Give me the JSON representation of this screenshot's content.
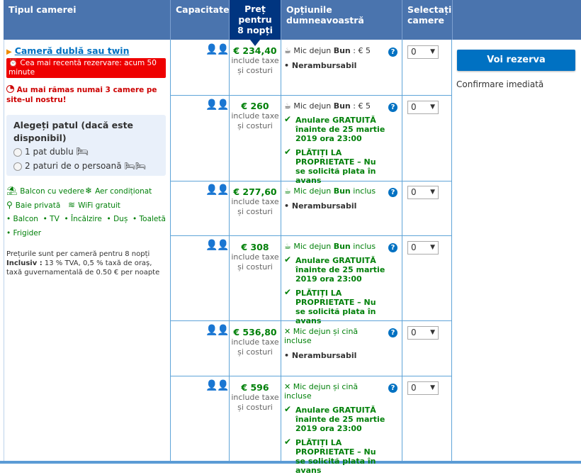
{
  "headers": {
    "room_type": "Tipul camerei",
    "capacity": "Capacitate",
    "price": "Preț pentru 8 nopți",
    "options": "Opțiunile dumneavoastră",
    "select": "Selectați camere"
  },
  "room": {
    "name": "Cameră dublă sau twin",
    "recent_booking": "Cea mai recentă rezervare: acum 50 minute",
    "scarcity": "Au mai rămas numai 3 camere pe site-ul nostru!",
    "bed_choice_title": "Alegeți patul (dacă este disponibil)",
    "bed_options": [
      "1 pat dublu",
      "2 paturi de o persoană"
    ],
    "facilities": {
      "balcony_view": "Balcon cu vedere",
      "ac": "Aer condiționat",
      "private_bath": "Baie privată",
      "wifi": "WiFi gratuit",
      "small": [
        "Balcon",
        "TV",
        "Încălzire",
        "Duș",
        "Toaletă",
        "Frigider"
      ]
    },
    "note_line1": "Prețurile sunt per cameră pentru 8 nopți",
    "note_bold": "Inclusiv :",
    "note_rest": "13 % TVA, 0,5 % taxă de oraș, taxă guvernamentală de 0.50 € per noapte"
  },
  "rows": [
    {
      "price": "€ 234,40",
      "tax": "include taxe și costuri",
      "meal": "Mic dejun Bun : € 5",
      "nonref": "Nerambursabil"
    },
    {
      "price": "€ 260",
      "tax": "include taxe și costuri",
      "meal": "Mic dejun Bun : € 5",
      "free_cancel": "Anulare GRATUITĂ înainte de 25 martie 2019 ora 23:00",
      "pay_later": "PLĂTIȚI LA PROPRIETATE – Nu se solicită plata în avans"
    },
    {
      "price": "€ 277,60",
      "tax": "include taxe și costuri",
      "meal": "Mic dejun Bun inclus",
      "nonref": "Nerambursabil"
    },
    {
      "price": "€ 308",
      "tax": "include taxe și costuri",
      "meal": "Mic dejun Bun inclus",
      "free_cancel": "Anulare GRATUITĂ înainte de 25 martie 2019 ora 23:00",
      "pay_later": "PLĂTIȚI LA PROPRIETATE – Nu se solicită plata în avans"
    },
    {
      "price": "€ 536,80",
      "tax": "include taxe și costuri",
      "meal": "Mic dejun și cină incluse",
      "nonref": "Nerambursabil"
    },
    {
      "price": "€ 596",
      "tax": "include taxe și costuri",
      "meal": "Mic dejun și cină incluse",
      "free_cancel": "Anulare GRATUITĂ înainte de 25 martie 2019 ora 23:00",
      "pay_later": "PLĂTIȚI LA PROPRIETATE – Nu se solicită plata în avans"
    }
  ],
  "select_value": "0",
  "help_icon": "?",
  "book_button": "Voi rezerva",
  "instant_confirm": "Confirmare imediată",
  "colors": {
    "header_blue": "#4a74ae",
    "price_header": "#003580",
    "green": "#008009",
    "alert_red": "#e00",
    "button_blue": "#0071c2"
  }
}
